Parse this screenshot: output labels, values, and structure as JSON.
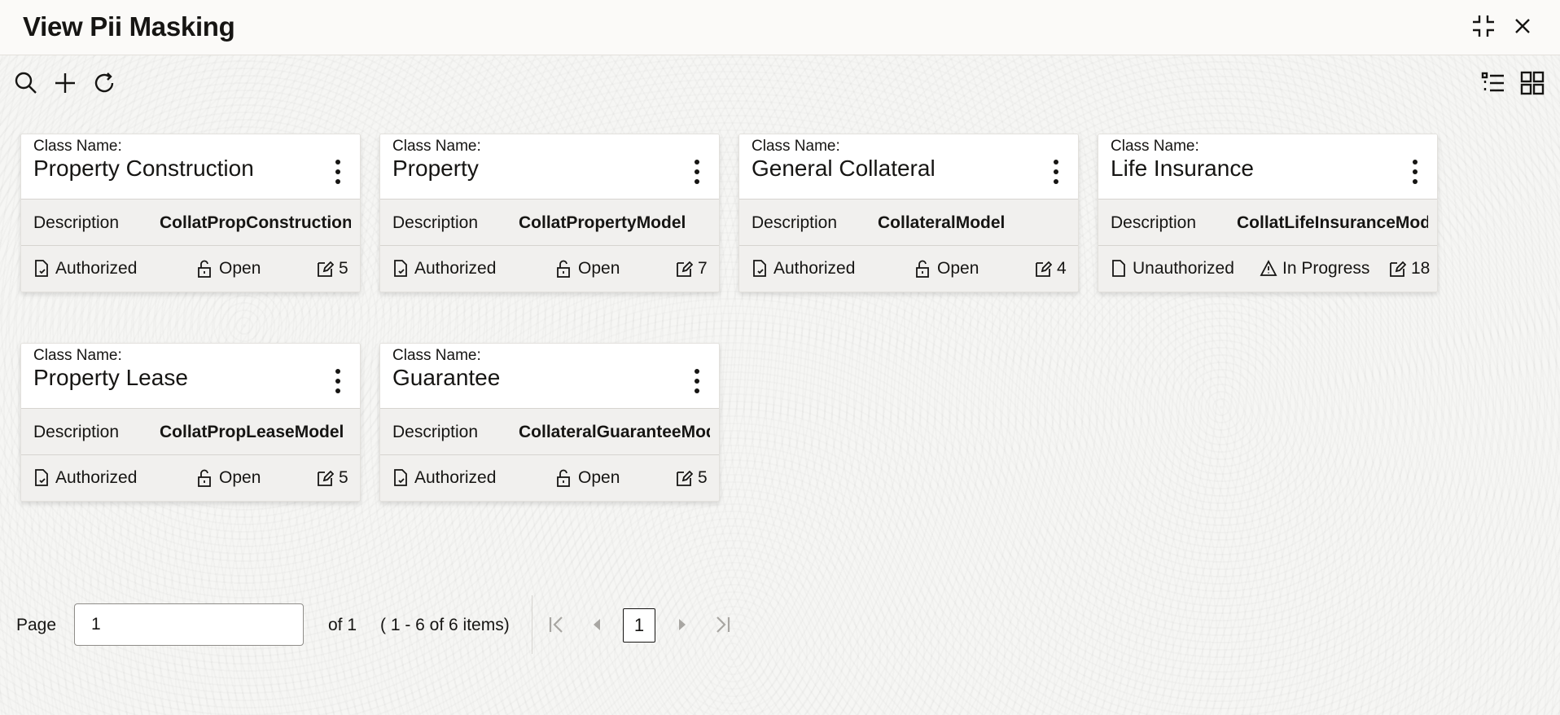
{
  "header": {
    "title": "View Pii Masking",
    "minimize_icon": "minimize-icon",
    "close_icon": "close-icon"
  },
  "toolbar": {
    "search_icon": "search-icon",
    "add_icon": "plus-icon",
    "refresh_icon": "refresh-icon",
    "list_view_icon": "list-view-icon",
    "grid_view_icon": "grid-view-icon"
  },
  "cards": [
    {
      "label": "Class Name:",
      "name": "Property Construction",
      "desc_label": "Description",
      "desc_value": "CollatPropConstructionModel",
      "status": "Authorized",
      "lock": "Open",
      "count": "5"
    },
    {
      "label": "Class Name:",
      "name": "Property",
      "desc_label": "Description",
      "desc_value": "CollatPropertyModel",
      "status": "Authorized",
      "lock": "Open",
      "count": "7"
    },
    {
      "label": "Class Name:",
      "name": "General Collateral",
      "desc_label": "Description",
      "desc_value": "CollateralModel",
      "status": "Authorized",
      "lock": "Open",
      "count": "4"
    },
    {
      "label": "Class Name:",
      "name": "Life Insurance",
      "desc_label": "Description",
      "desc_value": "CollatLifeInsuranceModel",
      "status": "Unauthorized",
      "lock": "In Progress",
      "count": "18"
    },
    {
      "label": "Class Name:",
      "name": "Property Lease",
      "desc_label": "Description",
      "desc_value": "CollatPropLeaseModel",
      "status": "Authorized",
      "lock": "Open",
      "count": "5"
    },
    {
      "label": "Class Name:",
      "name": "Guarantee",
      "desc_label": "Description",
      "desc_value": "CollateralGuaranteeModel",
      "status": "Authorized",
      "lock": "Open",
      "count": "5"
    }
  ],
  "pagination": {
    "page_label": "Page",
    "page_value": "1",
    "of_label": "of 1",
    "items_label": "( 1 - 6 of 6 items)",
    "current_page": "1"
  }
}
